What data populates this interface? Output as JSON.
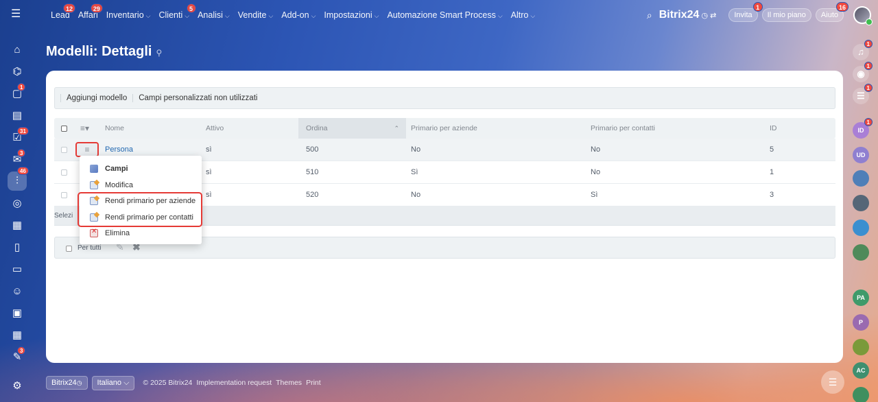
{
  "topbar": {
    "nav": [
      {
        "label": "Lead",
        "badge": "12",
        "chevron": false
      },
      {
        "label": "Affari",
        "badge": "29",
        "chevron": false
      },
      {
        "label": "Inventario",
        "badge": "",
        "chevron": true
      },
      {
        "label": "Clienti",
        "badge": "5",
        "chevron": true
      },
      {
        "label": "Analisi",
        "badge": "",
        "chevron": true
      },
      {
        "label": "Vendite",
        "badge": "",
        "chevron": true
      },
      {
        "label": "Add-on",
        "badge": "",
        "chevron": true
      },
      {
        "label": "Impostazioni",
        "badge": "",
        "chevron": true
      },
      {
        "label": "Automazione Smart Process",
        "badge": "",
        "chevron": true
      },
      {
        "label": "Altro",
        "badge": "",
        "chevron": true
      }
    ],
    "brand": "Bitrix24",
    "invite": {
      "label": "Invita",
      "badge": "1"
    },
    "my_plan": "Il mio piano",
    "help": {
      "label": "Aiuto",
      "badge": "16"
    }
  },
  "left_sidebar_badges": {
    "chat": "1",
    "tasks": "31",
    "mail": "3",
    "crm": "46",
    "feed": "3"
  },
  "right_sidebar": {
    "notifications_badge": "1",
    "copilot_badge": "1",
    "chat_badge": "1",
    "avatars": [
      {
        "initials": "ID",
        "color": "#a97fd6",
        "badge": "1"
      },
      {
        "initials": "UD",
        "color": "#8f7fd0",
        "badge": ""
      },
      {
        "initials": "",
        "color": "#4f7fb8",
        "badge": ""
      },
      {
        "initials": "",
        "color": "#556677",
        "badge": ""
      },
      {
        "initials": "",
        "color": "#3a8fd0",
        "badge": ""
      },
      {
        "initials": "",
        "color": "#4f8a5a",
        "badge": ""
      },
      {
        "initials": "PA",
        "color": "#3f9a6a",
        "badge": ""
      },
      {
        "initials": "P",
        "color": "#9a6ab0",
        "badge": ""
      },
      {
        "initials": "",
        "color": "#7a9a3a",
        "badge": ""
      },
      {
        "initials": "AC",
        "color": "#3f8f6f",
        "badge": ""
      },
      {
        "initials": "",
        "color": "#3f8f5f",
        "badge": ""
      }
    ]
  },
  "page": {
    "title": "Modelli: Dettagli"
  },
  "toolbar": {
    "add_model": "Aggiungi modello",
    "unused_fields": "Campi personalizzati non utilizzati"
  },
  "table": {
    "columns": {
      "name": "Nome",
      "active": "Attivo",
      "order": "Ordina",
      "primary_companies": "Primario per aziende",
      "primary_contacts": "Primario per contatti",
      "id": "ID"
    },
    "rows": [
      {
        "name": "Persona",
        "active": "sì",
        "order": "500",
        "primary_companies": "No",
        "primary_contacts": "No",
        "id": "5"
      },
      {
        "name": "",
        "active": "sì",
        "order": "510",
        "primary_companies": "Sì",
        "primary_contacts": "No",
        "id": "1"
      },
      {
        "name": "",
        "active": "sì",
        "order": "520",
        "primary_companies": "No",
        "primary_contacts": "Sì",
        "id": "3"
      }
    ],
    "footer_selected": "Selezi"
  },
  "actions": {
    "for_all": "Per tutti"
  },
  "context_menu": [
    {
      "label": "Campi",
      "icon": "fields-icon",
      "bold": true
    },
    {
      "label": "Modifica",
      "icon": "edit-icon",
      "bold": false
    },
    {
      "label": "Rendi primario per aziende",
      "icon": "edit-icon",
      "bold": false
    },
    {
      "label": "Rendi primario per contatti",
      "icon": "edit-icon",
      "bold": false
    },
    {
      "label": "Elimina",
      "icon": "delete-icon",
      "bold": false
    }
  ],
  "footer": {
    "brand": "Bitrix24",
    "language": "Italiano",
    "copyright": "© 2025 Bitrix24",
    "impl": "Implementation request",
    "themes": "Themes",
    "print": "Print"
  },
  "colors": {
    "accent_red": "#e53935",
    "badge_red": "#f0493e",
    "link_blue": "#2067b0"
  }
}
